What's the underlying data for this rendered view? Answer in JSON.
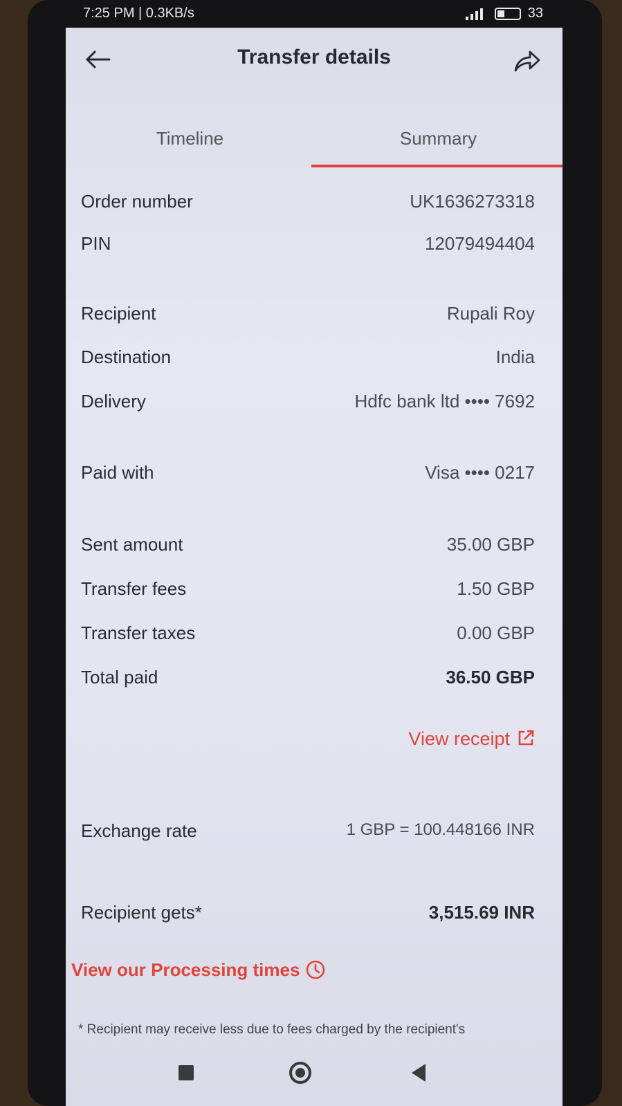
{
  "status_bar": {
    "left_text": "7:25 PM | 0.3KB/s",
    "battery": "33"
  },
  "header": {
    "title": "Transfer details"
  },
  "tabs": [
    {
      "label": "Timeline",
      "active": false
    },
    {
      "label": "Summary",
      "active": true
    }
  ],
  "details": {
    "order_number": {
      "label": "Order number",
      "value": "UK1636273318"
    },
    "pin": {
      "label": "PIN",
      "value": "12079494404"
    },
    "recipient": {
      "label": "Recipient",
      "value": "Rupali Roy"
    },
    "destination": {
      "label": "Destination",
      "value": "India"
    },
    "delivery": {
      "label": "Delivery",
      "value": "Hdfc bank ltd •••• 7692"
    },
    "paid_with": {
      "label": "Paid with",
      "value": "Visa •••• 0217"
    },
    "sent_amount": {
      "label": "Sent amount",
      "value": "35.00 GBP"
    },
    "transfer_fees": {
      "label": "Transfer fees",
      "value": "1.50 GBP"
    },
    "transfer_taxes": {
      "label": "Transfer taxes",
      "value": "0.00 GBP"
    },
    "total_paid": {
      "label": "Total paid",
      "value": "36.50 GBP"
    },
    "exchange_rate": {
      "label": "Exchange rate",
      "value": "1 GBP = 100.448166 INR"
    },
    "recipient_gets": {
      "label": "Recipient gets*",
      "value": "3,515.69 INR"
    }
  },
  "links": {
    "view_receipt": "View receipt",
    "processing_times": "View our Processing times"
  },
  "footnote": "* Recipient may receive less due to fees charged by the recipient's",
  "colors": {
    "accent": "#e0453b",
    "background": "#e4e5f1",
    "text": "#2b2b2e"
  },
  "icons": {
    "back": "arrow-left",
    "share": "share-arrow",
    "external": "external-link",
    "clock": "clock"
  }
}
